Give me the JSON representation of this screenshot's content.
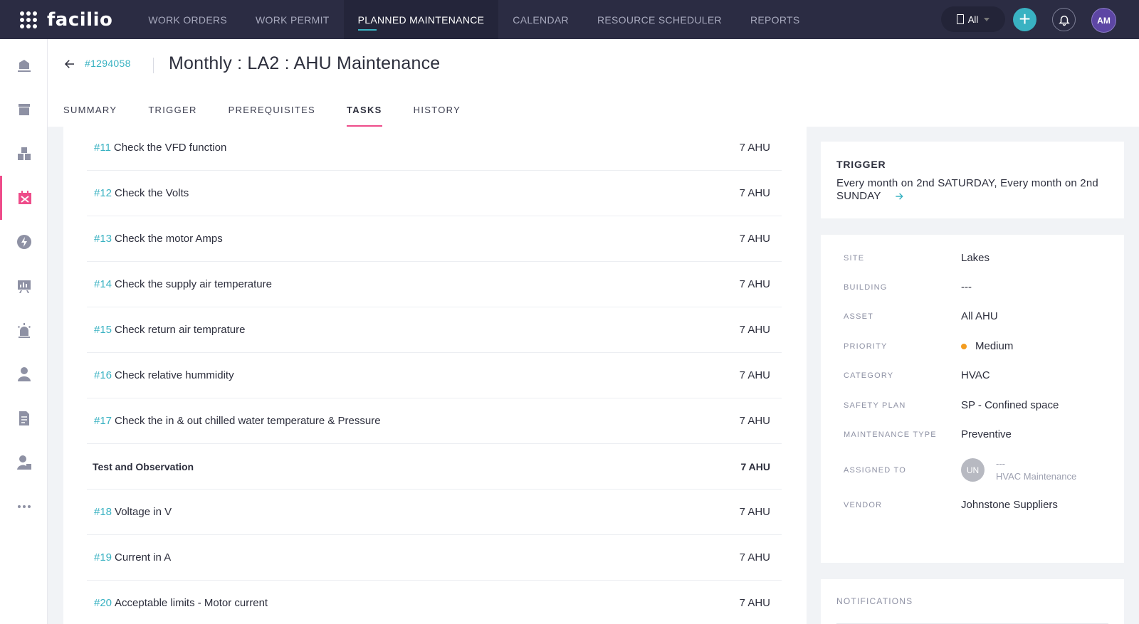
{
  "app": {
    "logo": "facilio"
  },
  "topnav": {
    "items": [
      "WORK ORDERS",
      "WORK PERMIT",
      "PLANNED MAINTENANCE",
      "CALENDAR",
      "RESOURCE SCHEDULER",
      "REPORTS"
    ],
    "active": "PLANNED MAINTENANCE"
  },
  "site_selector": {
    "value": "All"
  },
  "user": {
    "initials": "AM"
  },
  "header": {
    "pm_id": "#1294058",
    "title": "Monthly : LA2 : AHU Maintenance",
    "tabs": [
      "SUMMARY",
      "TRIGGER",
      "PREREQUISITES",
      "TASKS",
      "HISTORY"
    ],
    "active_tab": "TASKS"
  },
  "tasks": [
    {
      "num": "#11",
      "name": "Check the VFD function",
      "resource": "7 AHU"
    },
    {
      "num": "#12",
      "name": "Check the Volts",
      "resource": "7 AHU"
    },
    {
      "num": "#13",
      "name": "Check the motor Amps",
      "resource": "7 AHU"
    },
    {
      "num": "#14",
      "name": "Check the supply air temperature",
      "resource": "7 AHU"
    },
    {
      "num": "#15",
      "name": "Check return air temprature",
      "resource": "7 AHU"
    },
    {
      "num": "#16",
      "name": "Check relative hummidity",
      "resource": "7 AHU"
    },
    {
      "num": "#17",
      "name": "Check the in & out chilled water temperature & Pressure",
      "resource": "7 AHU"
    }
  ],
  "section": {
    "name": "Test and Observation",
    "resource": "7 AHU"
  },
  "section_tasks": [
    {
      "num": "#18",
      "name": "Voltage in V",
      "resource": "7 AHU"
    },
    {
      "num": "#19",
      "name": "Current in A",
      "resource": "7 AHU"
    },
    {
      "num": "#20",
      "name": "Acceptable limits - Motor current",
      "resource": "7 AHU"
    }
  ],
  "trigger": {
    "label": "TRIGGER",
    "text": "Every month on 2nd SATURDAY, Every month on 2nd SUNDAY"
  },
  "details": {
    "site": {
      "label": "SITE",
      "value": "Lakes"
    },
    "building": {
      "label": "BUILDING",
      "value": "---"
    },
    "asset": {
      "label": "ASSET",
      "value": "All AHU"
    },
    "priority": {
      "label": "PRIORITY",
      "value": "Medium",
      "color": "#f39c1f"
    },
    "category": {
      "label": "CATEGORY",
      "value": "HVAC"
    },
    "safety_plan": {
      "label": "SAFETY PLAN",
      "value": "SP - Confined space"
    },
    "maintenance_type": {
      "label": "MAINTENANCE TYPE",
      "value": "Preventive"
    },
    "assigned_to": {
      "label": "ASSIGNED TO",
      "initials": "UN",
      "name": "---",
      "team": "HVAC Maintenance"
    },
    "vendor": {
      "label": "VENDOR",
      "value": "Johnstone Suppliers"
    }
  },
  "notifications": {
    "label": "NOTIFICATIONS"
  },
  "colors": {
    "accent": "#39b2c2",
    "active_tab": "#ee4c8a",
    "topbar": "#2b2c43"
  }
}
